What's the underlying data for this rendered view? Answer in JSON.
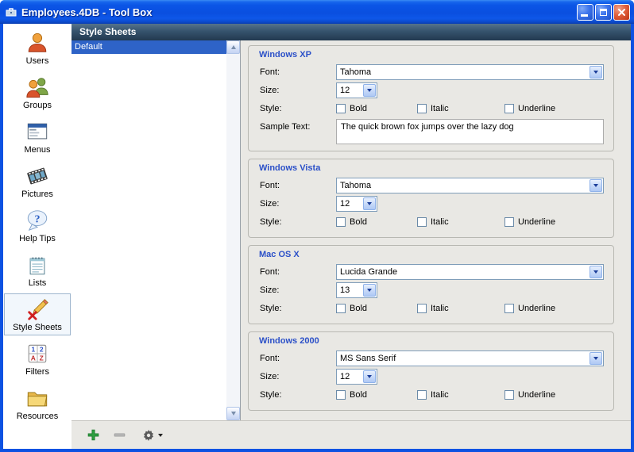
{
  "window": {
    "title": "Employees.4DB - Tool Box"
  },
  "colors": {
    "titlebar_blue": "#0A4FE0",
    "header_bar": "#36536D",
    "selection_blue": "#2E63C7",
    "group_title_blue": "#2B50C8",
    "add_green": "#2FA042",
    "main_background": "#E9E8E4"
  },
  "icons": {
    "titlebar": [
      "app-icon",
      "minimize-icon",
      "maximize-icon",
      "close-icon"
    ],
    "toolbar": [
      "plus-icon",
      "minus-icon",
      "gear-icon",
      "chevron-down-icon"
    ]
  },
  "sidebar": {
    "items": [
      {
        "label": "Users",
        "icon": "users-icon",
        "selected": false
      },
      {
        "label": "Groups",
        "icon": "groups-icon",
        "selected": false
      },
      {
        "label": "Menus",
        "icon": "menus-icon",
        "selected": false
      },
      {
        "label": "Pictures",
        "icon": "pictures-icon",
        "selected": false
      },
      {
        "label": "Help Tips",
        "icon": "help-tips-icon",
        "selected": false
      },
      {
        "label": "Lists",
        "icon": "lists-icon",
        "selected": false
      },
      {
        "label": "Style Sheets",
        "icon": "style-sheets-icon",
        "selected": true
      },
      {
        "label": "Filters",
        "icon": "filters-icon",
        "selected": false
      },
      {
        "label": "Resources",
        "icon": "resources-icon",
        "selected": false
      }
    ]
  },
  "header": {
    "title": "Style Sheets"
  },
  "style_list": {
    "items": [
      {
        "label": "Default",
        "selected": true
      }
    ]
  },
  "field_labels": {
    "font": "Font:",
    "size": "Size:",
    "style": "Style:",
    "sample_text": "Sample Text:"
  },
  "panels": [
    {
      "title": "Windows XP",
      "font": "Tahoma",
      "size": "12",
      "styles": [
        {
          "label": "Bold",
          "checked": false
        },
        {
          "label": "Italic",
          "checked": false
        },
        {
          "label": "Underline",
          "checked": false
        }
      ],
      "sample": "The quick brown fox jumps over the lazy dog"
    },
    {
      "title": "Windows Vista",
      "font": "Tahoma",
      "size": "12",
      "styles": [
        {
          "label": "Bold",
          "checked": false
        },
        {
          "label": "Italic",
          "checked": false
        },
        {
          "label": "Underline",
          "checked": false
        }
      ]
    },
    {
      "title": "Mac OS X",
      "font": "Lucida Grande",
      "size": "13",
      "styles": [
        {
          "label": "Bold",
          "checked": false
        },
        {
          "label": "Italic",
          "checked": false
        },
        {
          "label": "Underline",
          "checked": false
        }
      ]
    },
    {
      "title": "Windows 2000",
      "font": "MS Sans Serif",
      "size": "12",
      "styles": [
        {
          "label": "Bold",
          "checked": false
        },
        {
          "label": "Italic",
          "checked": false
        },
        {
          "label": "Underline",
          "checked": false
        }
      ]
    }
  ]
}
